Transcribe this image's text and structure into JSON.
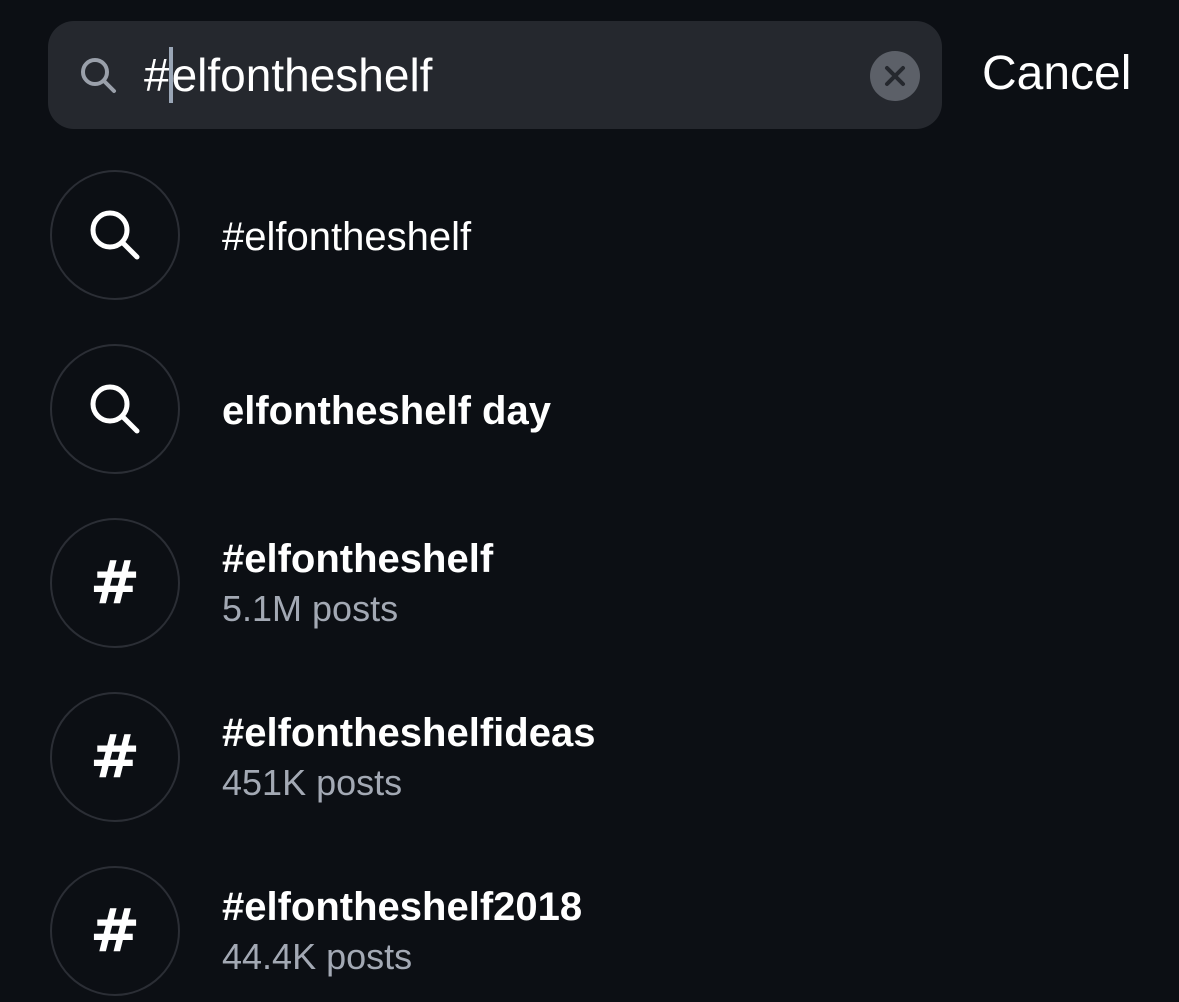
{
  "search": {
    "query_prefix": "#",
    "query_rest": "elfontheshelf",
    "cancel_label": "Cancel"
  },
  "results": [
    {
      "type": "search",
      "icon": "search-icon",
      "label": "#elfontheshelf",
      "style": "regular"
    },
    {
      "type": "search",
      "icon": "search-icon",
      "label": "elfontheshelf day",
      "style": "bold"
    },
    {
      "type": "hashtag",
      "icon": "hashtag-icon",
      "label": "#elfontheshelf",
      "sub": "5.1M posts"
    },
    {
      "type": "hashtag",
      "icon": "hashtag-icon",
      "label": "#elfontheshelfideas",
      "sub": "451K posts"
    },
    {
      "type": "hashtag",
      "icon": "hashtag-icon",
      "label": "#elfontheshelf2018",
      "sub": "44.4K posts"
    }
  ],
  "colors": {
    "background": "#0c0f14",
    "search_field": "#25282e",
    "secondary_text": "#a3a9b4",
    "caret": "#9aa6b6"
  }
}
